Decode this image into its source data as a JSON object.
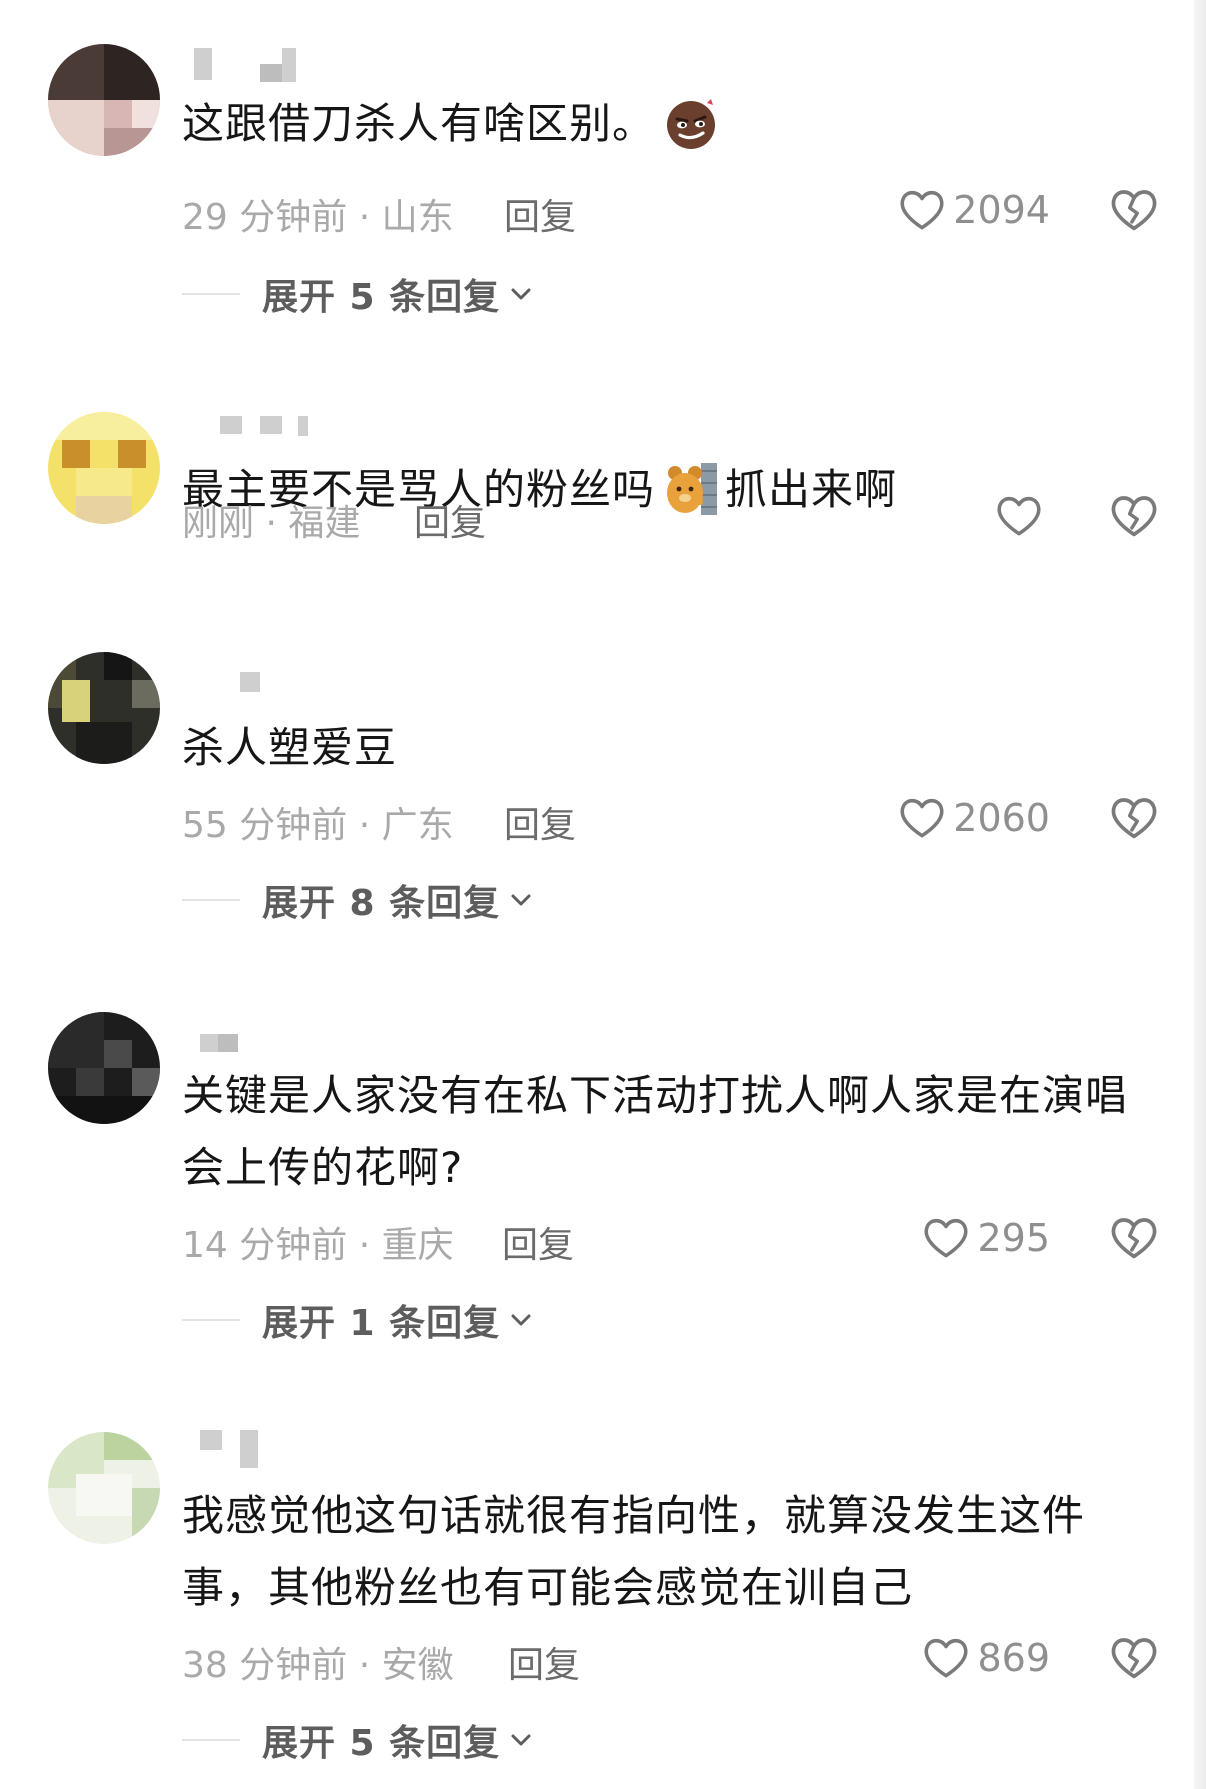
{
  "colors": {
    "text": "#161616",
    "meta": "#a9a9a9",
    "reply": "#6b6b6b",
    "icon": "#7a7a7a"
  },
  "comments": [
    {
      "text": "这跟借刀杀人有啥区别。",
      "emoji": "smirk-emoji",
      "meta": "29 分钟前 · 山东",
      "reply_label": "回复",
      "likes": "2094",
      "expand_label": "展开 5 条回复"
    },
    {
      "text_before": "最主要不是骂人的粉丝吗",
      "emoji": "peeking-bear-emoji",
      "text_after": "抓出来啊",
      "meta": "刚刚 · 福建",
      "reply_label": "回复",
      "likes": ""
    },
    {
      "text": "杀人塑爱豆",
      "meta": "55 分钟前 · 广东",
      "reply_label": "回复",
      "likes": "2060",
      "expand_label": "展开 8 条回复"
    },
    {
      "text": "关键是人家没有在私下活动打扰人啊人家是在演唱会上传的花啊?",
      "meta": "14 分钟前 · 重庆",
      "reply_label": "回复",
      "likes": "295",
      "expand_label": "展开 1 条回复"
    },
    {
      "text": "我感觉他这句话就很有指向性，就算没发生这件事，其他粉丝也有可能会感觉在训自己",
      "meta": "38 分钟前 · 安徽",
      "reply_label": "回复",
      "likes": "869",
      "expand_label": "展开 5 条回复"
    }
  ]
}
